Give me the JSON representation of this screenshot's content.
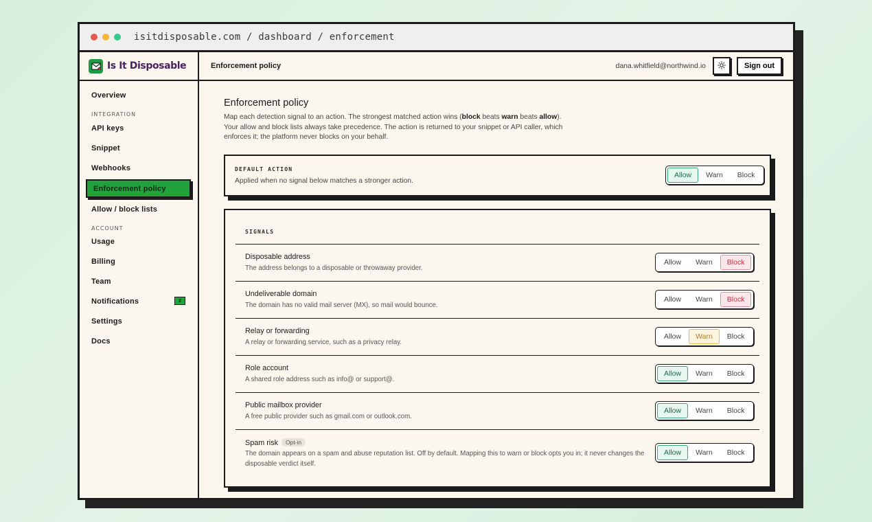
{
  "browser": {
    "url": "isitdisposable.com / dashboard / enforcement"
  },
  "header": {
    "brand": "Is It Disposable",
    "page_title": "Enforcement policy",
    "user_email": "dana.whitfield@northwind.io",
    "signout_label": "Sign out"
  },
  "sidebar": {
    "overview": "Overview",
    "section_integration": "INTEGRATION",
    "api_keys": "API keys",
    "snippet": "Snippet",
    "webhooks": "Webhooks",
    "enforcement_policy": "Enforcement policy",
    "allow_block_lists": "Allow / block lists",
    "section_account": "ACCOUNT",
    "usage": "Usage",
    "billing": "Billing",
    "team": "Team",
    "notifications": "Notifications",
    "notifications_badge": "2",
    "settings": "Settings",
    "docs": "Docs",
    "active_item": "Enforcement policy"
  },
  "main": {
    "title": "Enforcement policy",
    "desc_1": "Map each detection signal to an action. The strongest matched action wins (",
    "desc_block": "block",
    "desc_2": " beats ",
    "desc_warn": "warn",
    "desc_3": " beats ",
    "desc_allow": "allow",
    "desc_4": "). Your allow and block lists always take precedence. The action is returned to your snippet or API caller, which enforces it; the platform never blocks on your behalf."
  },
  "actions": [
    "Allow",
    "Warn",
    "Block"
  ],
  "default_action": {
    "label": "DEFAULT ACTION",
    "description": "Applied when no signal below matches a stronger action.",
    "selected": "Allow"
  },
  "signals": {
    "label": "SIGNALS",
    "items": [
      {
        "title": "Disposable address",
        "description": "The address belongs to a disposable or throwaway provider.",
        "selected": "Block"
      },
      {
        "title": "Undeliverable domain",
        "description": "The domain has no valid mail server (MX), so mail would bounce.",
        "selected": "Block"
      },
      {
        "title": "Relay or forwarding",
        "description": "A relay or forwarding service, such as a privacy relay.",
        "selected": "Warn"
      },
      {
        "title": "Role account",
        "description": "A shared role address such as info@ or support@.",
        "selected": "Allow"
      },
      {
        "title": "Public mailbox provider",
        "description": "A free public provider such as gmail.com or outlook.com.",
        "selected": "Allow"
      },
      {
        "title": "Spam risk",
        "badge": "Opt-in",
        "description": "The domain appears on a spam and abuse reputation list. Off by default. Mapping this to warn or block opts you in; it never changes the disposable verdict itself.",
        "selected": "Allow"
      }
    ]
  },
  "colors": {
    "accent_green": "#22a23d",
    "brand_purple": "#4a2260",
    "allow": "#1d6a4a",
    "warn": "#b9791b",
    "block": "#c4333f"
  }
}
